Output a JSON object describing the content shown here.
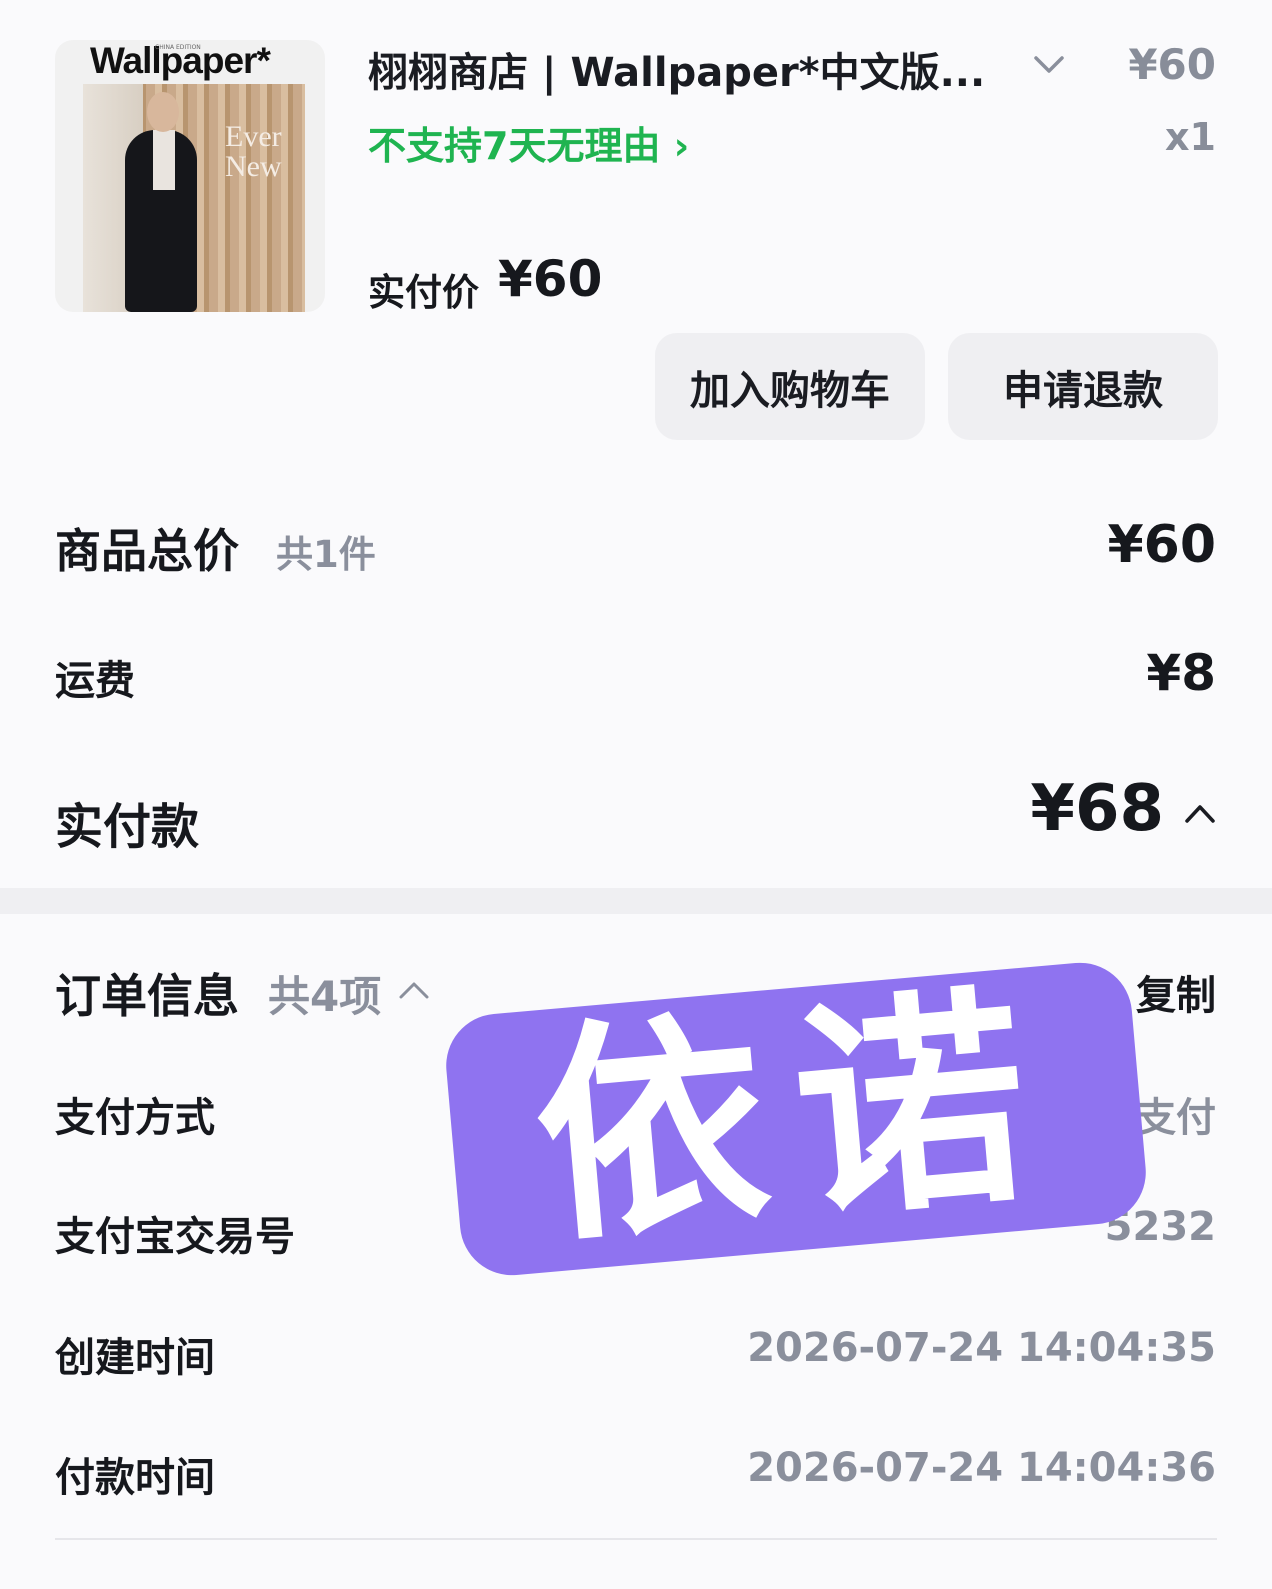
{
  "product": {
    "cover_masthead": "Wallpaper*",
    "cover_edition": "CHINA EDITION",
    "cover_headline_1": "Ever",
    "cover_headline_2": "New",
    "title": "栩栩商店 | Wallpaper*中文版...",
    "unit_price": "¥60",
    "return_policy": "不支持7天无理由 ›",
    "quantity": "x1",
    "paid_label": "实付价",
    "paid_price": "¥60"
  },
  "actions": {
    "add_to_cart": "加入购物车",
    "refund": "申请退款"
  },
  "summary": {
    "goods_total_label": "商品总价",
    "goods_count": "共1件",
    "goods_total": "¥60",
    "shipping_label": "运费",
    "shipping": "¥8",
    "paid_label": "实付款",
    "paid": "¥68"
  },
  "order_info": {
    "title": "订单信息",
    "count": "共4项",
    "copy": "复制",
    "rows": [
      {
        "label": "支付方式",
        "value": "支付"
      },
      {
        "label": "支付宝交易号",
        "value": "5232"
      },
      {
        "label": "创建时间",
        "value": "2026-07-24 14:04:35"
      },
      {
        "label": "付款时间",
        "value": "2026-07-24 14:04:36"
      }
    ]
  },
  "watermark": "依诺",
  "icons": [
    "chevron-down-icon",
    "chevron-right-icon",
    "chevron-up-icon"
  ]
}
